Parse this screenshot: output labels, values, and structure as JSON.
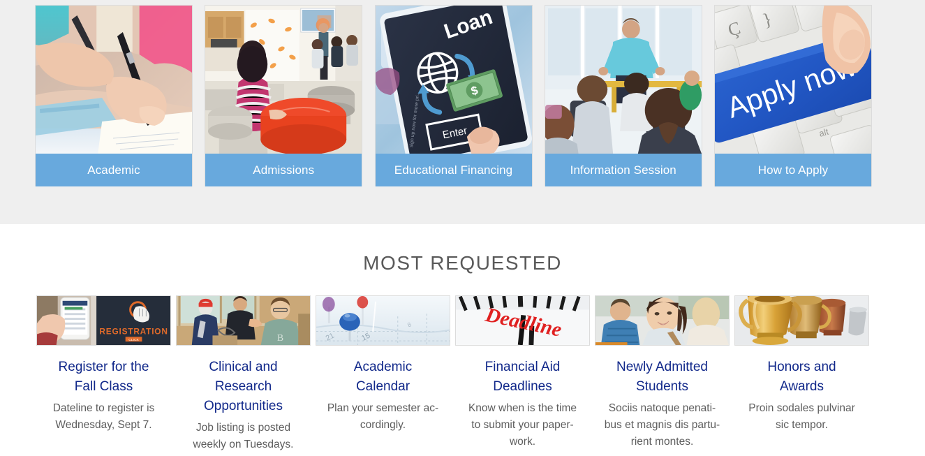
{
  "top_section": {
    "background_color": "#efefef",
    "label_bar_color": "#68a9dd",
    "cards": [
      {
        "label": "Academic",
        "image_alt": "students-writing-in-notebooks-photo"
      },
      {
        "label": "Admissions",
        "image_alt": "students-in-modern-lounge-presentation-photo"
      },
      {
        "label": "Educational Financing",
        "image_alt": "tablet-loan-screen-with-globe-and-money-photo"
      },
      {
        "label": "Information Session",
        "image_alt": "instructor-teaching-classroom-photo"
      },
      {
        "label": "How to Apply",
        "image_alt": "blue-apply-now-keyboard-key-photo"
      }
    ]
  },
  "most_requested": {
    "heading": "MOST REQUESTED",
    "heading_color": "#595959",
    "link_color": "#11288a",
    "items": [
      {
        "title_lines": [
          "Register for the",
          "Fall Class"
        ],
        "desc_lines": [
          "Dateline to register is",
          "Wednesday, Sept 7."
        ],
        "image_alt": "phone-registration-screen-photo"
      },
      {
        "title_lines": [
          "Clinical and",
          "Research",
          "Opportunities"
        ],
        "desc_lines": [
          "Job listing is posted",
          "weekly on Tuesdays."
        ],
        "image_alt": "students-collaborating-in-classroom-photo"
      },
      {
        "title_lines": [
          "Academic",
          "Calendar"
        ],
        "desc_lines": [
          "Plan your semester ac-",
          "cordingly."
        ],
        "image_alt": "pushpins-on-calendar-photo"
      },
      {
        "title_lines": [
          "Financial Aid",
          "Deadlines"
        ],
        "desc_lines": [
          "Know when is the time",
          "to submit your paper-",
          "work."
        ],
        "image_alt": "clock-face-with-deadline-text-photo"
      },
      {
        "title_lines": [
          "Newly Admitted",
          "Students"
        ],
        "desc_lines": [
          "Sociis natoque penati-",
          "bus et magnis dis partu-",
          "rient montes."
        ],
        "image_alt": "smiling-student-with-friends-photo"
      },
      {
        "title_lines": [
          "Honors and",
          "Awards"
        ],
        "desc_lines": [
          "Proin sodales pulvinar",
          "sic tempor."
        ],
        "image_alt": "gold-trophy-cups-photo"
      }
    ]
  }
}
